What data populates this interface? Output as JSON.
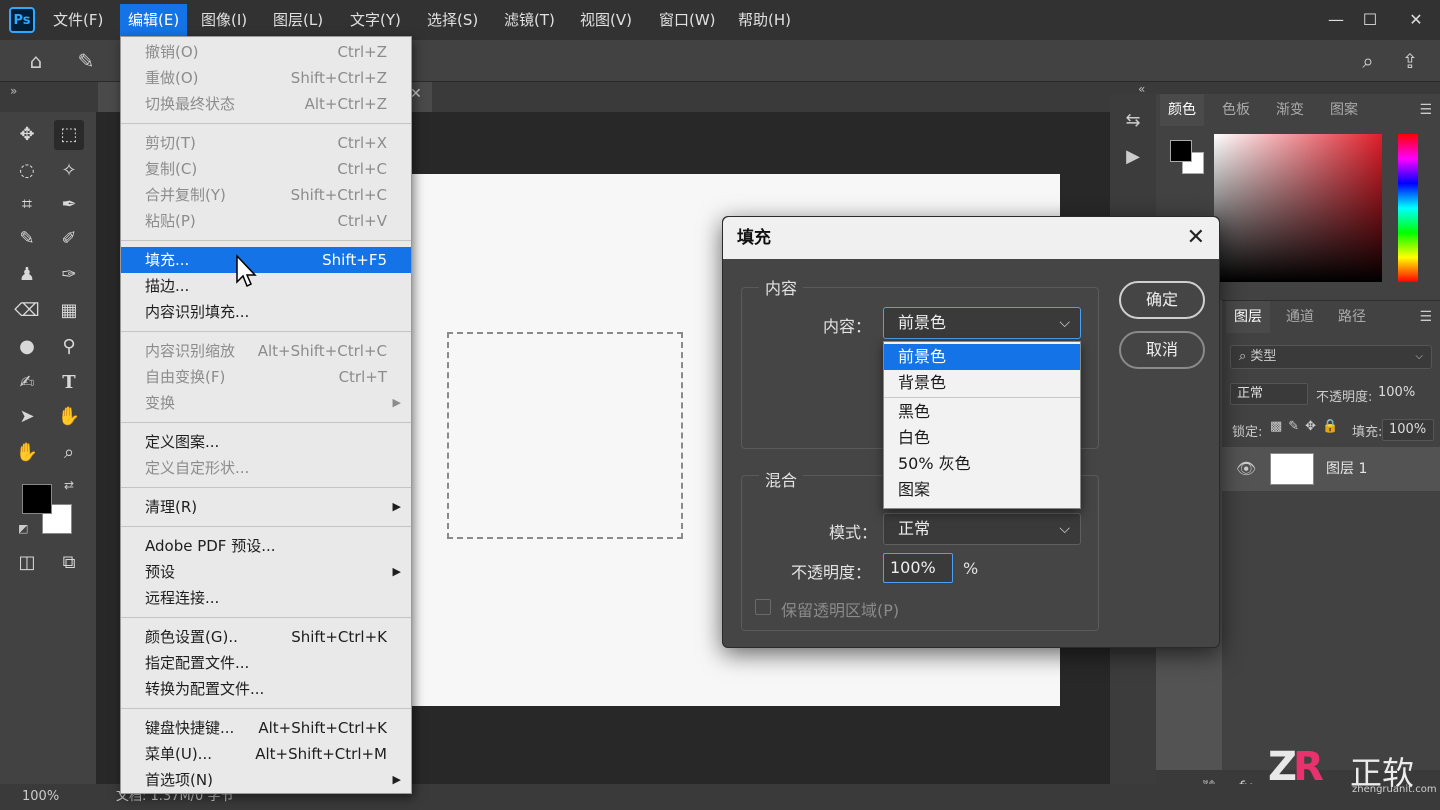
{
  "app": {
    "logo": "Ps"
  },
  "menubar": {
    "items": [
      "文件(F)",
      "编辑(E)",
      "图像(I)",
      "图层(L)",
      "文字(Y)",
      "选择(S)",
      "滤镜(T)",
      "视图(V)",
      "窗口(W)",
      "帮助(H)"
    ],
    "active_index": 1
  },
  "edit_menu": {
    "groups": [
      [
        {
          "label": "撤销(O)",
          "shortcut": "Ctrl+Z",
          "disabled": true
        },
        {
          "label": "重做(O)",
          "shortcut": "Shift+Ctrl+Z",
          "disabled": true
        },
        {
          "label": "切换最终状态",
          "shortcut": "Alt+Ctrl+Z",
          "disabled": true
        }
      ],
      [
        {
          "label": "剪切(T)",
          "shortcut": "Ctrl+X",
          "disabled": true
        },
        {
          "label": "复制(C)",
          "shortcut": "Ctrl+C",
          "disabled": true
        },
        {
          "label": "合并复制(Y)",
          "shortcut": "Shift+Ctrl+C",
          "disabled": true
        },
        {
          "label": "粘贴(P)",
          "shortcut": "Ctrl+V",
          "disabled": true
        }
      ],
      [
        {
          "label": "填充...",
          "shortcut": "Shift+F5",
          "highlighted": true
        },
        {
          "label": "描边..."
        },
        {
          "label": "内容识别填充..."
        }
      ],
      [
        {
          "label": "内容识别缩放",
          "shortcut": "Alt+Shift+Ctrl+C",
          "disabled": true
        },
        {
          "label": "自由变换(F)",
          "shortcut": "Ctrl+T",
          "disabled": true
        },
        {
          "label": "变换",
          "disabled": true,
          "submenu": true
        }
      ],
      [
        {
          "label": "定义图案..."
        },
        {
          "label": "定义自定形状...",
          "disabled": true
        }
      ],
      [
        {
          "label": "清理(R)",
          "submenu": true
        }
      ],
      [
        {
          "label": "Adobe PDF 预设..."
        },
        {
          "label": "预设",
          "submenu": true
        },
        {
          "label": "远程连接..."
        }
      ],
      [
        {
          "label": "颜色设置(G)..",
          "shortcut": "Shift+Ctrl+K"
        },
        {
          "label": "指定配置文件..."
        },
        {
          "label": "转换为配置文件..."
        }
      ],
      [
        {
          "label": "键盘快捷键...",
          "shortcut": "Alt+Shift+Ctrl+K"
        },
        {
          "label": "菜单(U)...",
          "shortcut": "Alt+Shift+Ctrl+M"
        },
        {
          "label": "首选项(N)",
          "submenu": true
        }
      ]
    ]
  },
  "fill_dialog": {
    "title": "填充",
    "content_group": "内容",
    "content_label": "内容：",
    "content_value": "前景色",
    "content_options": [
      "前景色",
      "背景色",
      "黑色",
      "白色",
      "50% 灰色",
      "图案"
    ],
    "content_selected_index": 0,
    "blend_group": "混合",
    "mode_label": "模式：",
    "mode_value": "正常",
    "opacity_label": "不透明度：",
    "opacity_value": "100%",
    "opacity_unit": "%",
    "preserve_label": "保留透明区域(P)",
    "ok": "确定",
    "cancel": "取消"
  },
  "color_panel": {
    "tabs": [
      "颜色",
      "色板",
      "渐变",
      "图案"
    ],
    "foreground": "#000000",
    "background": "#ffffff"
  },
  "layers_panel": {
    "tabs": [
      "图层",
      "通道",
      "路径"
    ],
    "search_placeholder": "类型",
    "blend_mode": "正常",
    "opacity_label": "不透明度:",
    "opacity_value": "100%",
    "lock_label": "锁定:",
    "fill_label": "填充:",
    "fill_value": "100%",
    "layer_name": "图层 1"
  },
  "statusbar": {
    "zoom": "100%",
    "doc_info": "文档: 1.37M/0 字节"
  },
  "watermark": {
    "logo": "ZR",
    "name": "正软",
    "site": "zhengruanit.com"
  },
  "colors": {
    "accent": "#1473e6",
    "menubar": "#323232",
    "panel": "#424242"
  }
}
